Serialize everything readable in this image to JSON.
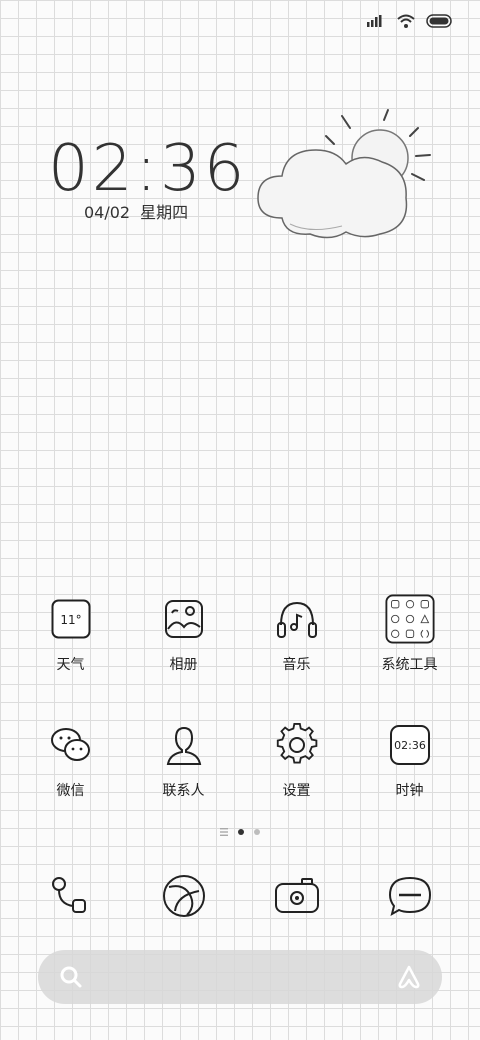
{
  "status_bar": {
    "signal": "signal-icon",
    "wifi": "wifi-icon",
    "battery": "battery-icon"
  },
  "clock": {
    "time": "02:36",
    "date": "04/02",
    "weekday": "星期四"
  },
  "weather_widget": {
    "icon": "partly-cloudy-icon"
  },
  "apps_row1": [
    {
      "label": "天气",
      "icon": "weather-icon",
      "badge": "11°"
    },
    {
      "label": "相册",
      "icon": "gallery-icon"
    },
    {
      "label": "音乐",
      "icon": "headphones-icon"
    },
    {
      "label": "系统工具",
      "icon": "folder-grid-icon"
    }
  ],
  "apps_row2": [
    {
      "label": "微信",
      "icon": "wechat-icon"
    },
    {
      "label": "联系人",
      "icon": "contacts-icon"
    },
    {
      "label": "设置",
      "icon": "gear-icon"
    },
    {
      "label": "时钟",
      "icon": "clock-icon",
      "badge": "02:36"
    }
  ],
  "page_indicator": {
    "pages": 2,
    "current": 1
  },
  "dock": [
    {
      "icon": "phone-icon"
    },
    {
      "icon": "browser-icon"
    },
    {
      "icon": "camera-icon"
    },
    {
      "icon": "message-icon"
    }
  ],
  "search_bar": {
    "left_icon": "search-icon",
    "right_icon": "assistant-icon"
  }
}
